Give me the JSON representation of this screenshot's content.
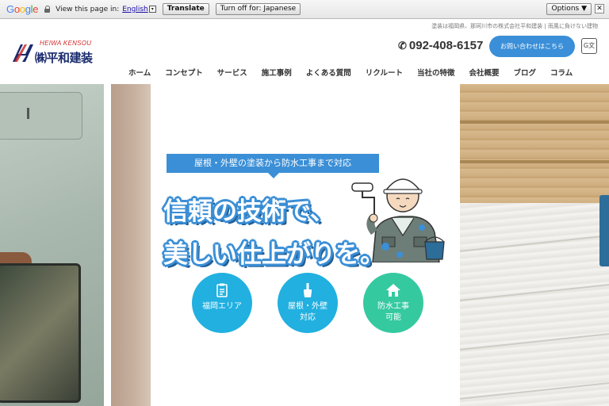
{
  "translate_bar": {
    "logo": "Google",
    "prompt": "View this page in:",
    "language": "English",
    "translate_button": "Translate",
    "turn_off_button": "Turn off for: Japanese",
    "options_button": "Options ▼",
    "close": "✕"
  },
  "header": {
    "tagline": "塗装は福岡県、那珂川市の株式会社平和建装 | 雨風に負けない建物",
    "logo_en": "HEIWA KENSOU",
    "logo_jp": "㈱平和建装",
    "phone": "092-408-6157",
    "contact_button": "お問い合わせはこちら",
    "translate_icon_text": "G文"
  },
  "nav": {
    "items": [
      "ホーム",
      "コンセプト",
      "サービス",
      "施工事例",
      "よくある質問",
      "リクルート",
      "当社の特徴",
      "会社概要",
      "ブログ",
      "コラム"
    ]
  },
  "hero": {
    "banner": "屋根・外壁の塗装から防水工事まで対応",
    "headline_1": "信頼の技術で、",
    "headline_2": "美しい仕上がりを。",
    "circles": [
      {
        "label_1": "福岡エリア",
        "label_2": "",
        "icon": "clipboard-icon",
        "color": "#21b0e0"
      },
      {
        "label_1": "屋根・外壁",
        "label_2": "対応",
        "icon": "paint-brush-icon",
        "color": "#21b0e0"
      },
      {
        "label_1": "防水工事",
        "label_2": "可能",
        "icon": "house-icon",
        "color": "#35c9a0"
      }
    ]
  },
  "colors": {
    "accent": "#3b8fd6",
    "brand_blue": "#1a2b6e",
    "brand_red": "#d02a2a"
  }
}
